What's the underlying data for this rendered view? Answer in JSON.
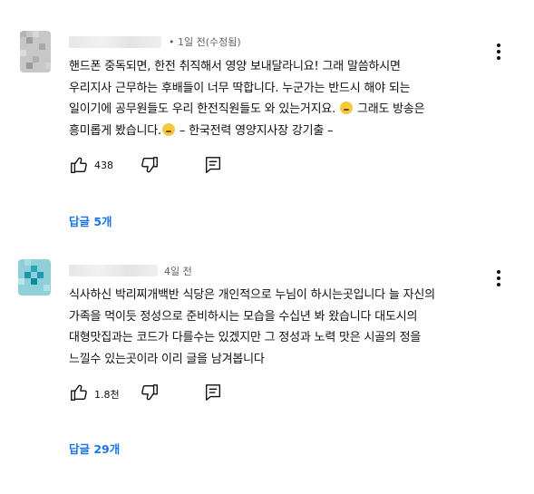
{
  "comments": [
    {
      "author": "",
      "meta": "• 1일 전(수정됨)",
      "lines": [
        "핸드폰 중독되면, 한전 취직해서 영양 보내달라니요! 그래 말씀하시면",
        "우리지사 근무하는 후배들이 너무 딱합니다. 누군가는 반드시 해야 되는",
        "일이기에 공무원들도 우리 한전직원들도 와 있는거지요.",
        "그래도 방송은",
        "흥미롭게 봤습니다.",
        "– 한국전력 영양지사장 강기출 –"
      ],
      "emoji_1": "sweat-smile-emoji",
      "emoji_2": "crying-emoji",
      "likes": "438",
      "replies": "답글 5개"
    },
    {
      "author": "",
      "meta": "4일 전",
      "lines": [
        "식사하신 박리찌개백반 식당은 개인적으로 누님이  하시는곳입니다 늘 자신의",
        "가족을 먹이듯 정성으로 준비하시는 모습을 수십년 봐 왔습니다 대도시의",
        "대형맛집과는 코드가 다를수는 있겠지만 그 정성과 노력  맛은 시골의 정을",
        "느낄수 있는곳이라 이리 글을 남겨봅니다"
      ],
      "likes": "1.8천",
      "replies": "답글 29개"
    }
  ],
  "colors": {
    "link": "#1a73e8",
    "meta": "#606060",
    "text": "#0f0f0f"
  },
  "icons": [
    "thumbs-up-icon",
    "thumbs-down-icon",
    "reply-icon",
    "more-vert-icon"
  ]
}
